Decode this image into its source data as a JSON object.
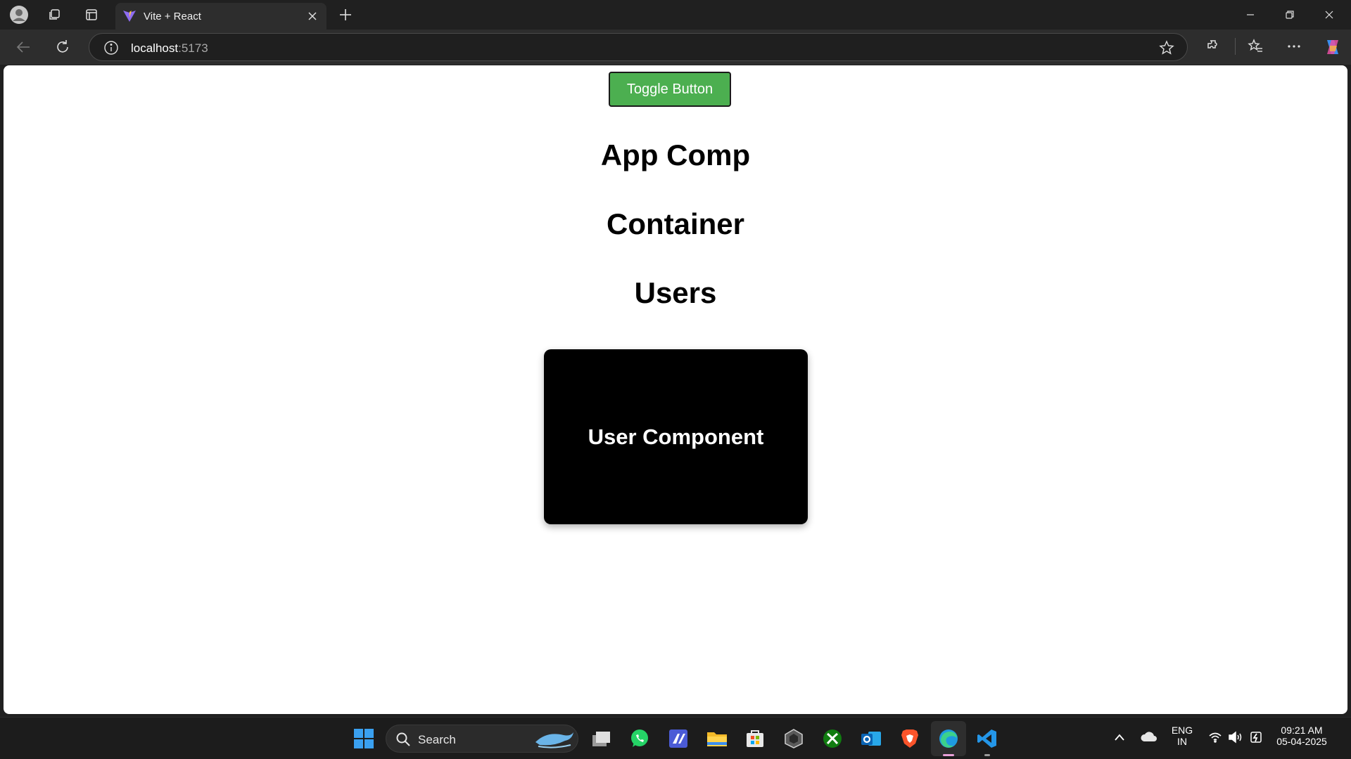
{
  "browser": {
    "tab_title": "Vite + React",
    "url_host": "localhost",
    "url_port": ":5173"
  },
  "page": {
    "toggle_button_label": "Toggle Button",
    "headings": [
      "App Comp",
      "Container",
      "Users"
    ],
    "user_card_label": "User Component",
    "colors": {
      "toggle_button_bg": "#4caf50",
      "card_bg": "#000000"
    }
  },
  "taskbar": {
    "search_label": "Search",
    "language_line1": "ENG",
    "language_line2": "IN",
    "time": "09:21 AM",
    "date": "05-04-2025",
    "apps": [
      "start-icon",
      "search-icon",
      "task-view-icon",
      "whatsapp-icon",
      "editor-app-icon",
      "file-explorer-icon",
      "microsoft-store-icon",
      "unity-icon",
      "xbox-icon",
      "outlook-icon",
      "brave-icon",
      "edge-icon",
      "vscode-icon"
    ]
  }
}
